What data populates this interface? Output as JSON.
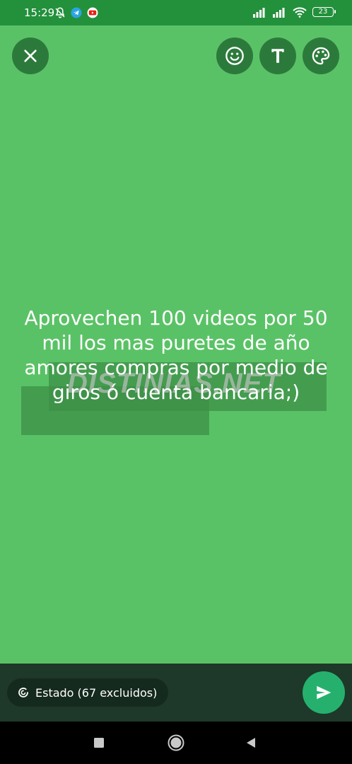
{
  "status_bar": {
    "time": "15:29",
    "battery": "23"
  },
  "editor": {
    "text": "Aprovechen 100 videos por 50 mil los mas puretes de año amores compras por medio de giros ó cuenta bancaria;)",
    "watermark": "DISTINIAS.NET",
    "background_color": "#5ac266"
  },
  "bottom_bar": {
    "audience_label": "Estado (67 excluidos)"
  },
  "icons": {
    "close": "close-icon",
    "emoji": "emoji-icon",
    "text": "text-icon",
    "palette": "palette-icon",
    "send": "send-icon"
  }
}
